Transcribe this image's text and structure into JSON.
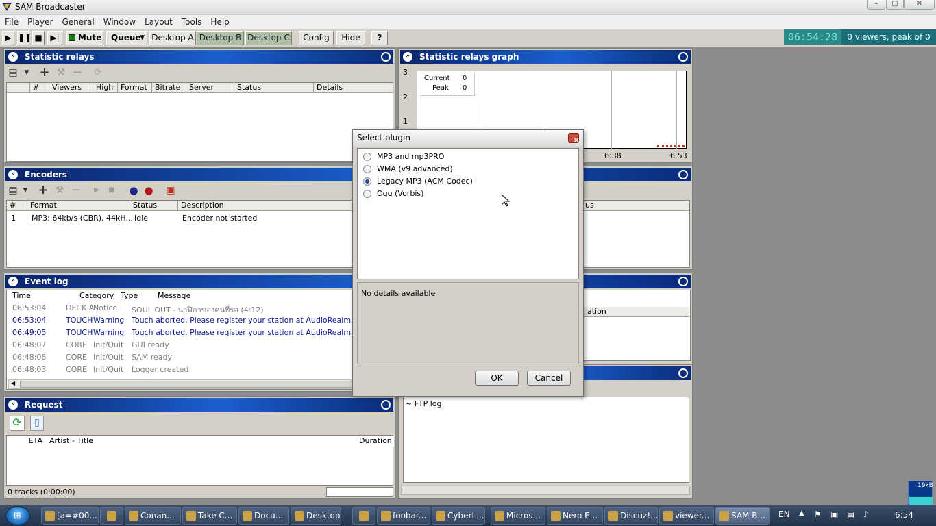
{
  "app": {
    "title": "SAM Broadcaster"
  },
  "menu": [
    "File",
    "Player",
    "General",
    "Window",
    "Layout",
    "Tools",
    "Help"
  ],
  "toolbar": {
    "mute": "Mute",
    "queue": "Queue",
    "desktop_a": "Desktop A",
    "desktop_b": "Desktop B",
    "desktop_c": "Desktop C",
    "config": "Config",
    "hide": "Hide",
    "help": "?",
    "clock": "06:54:28",
    "viewers": "0 viewers, peak of 0"
  },
  "statistic_relays": {
    "title": "Statistic relays",
    "columns": [
      "#",
      "Viewers",
      "High",
      "Format",
      "Bitrate",
      "Server",
      "Status",
      "Details"
    ]
  },
  "relays_graph": {
    "title": "Statistic relays graph",
    "y_ticks": [
      "3",
      "2",
      "1"
    ],
    "x_ticks": [
      "6:38",
      "6:53"
    ],
    "legend": [
      {
        "label": "Current",
        "value": "0"
      },
      {
        "label": "Peak",
        "value": "0"
      }
    ]
  },
  "encoders": {
    "title": "Encoders",
    "columns": [
      "#",
      "Format",
      "Status",
      "Description"
    ],
    "right_col_partial": "us",
    "rows": [
      {
        "num": "1",
        "format": "MP3: 64kb/s (CBR), 44kH...",
        "status": "Idle",
        "description": "Encoder not started"
      }
    ]
  },
  "event_log": {
    "title": "Event log",
    "columns": [
      "Time",
      "Category",
      "Type",
      "Message"
    ],
    "right_col_partial": "ation",
    "rows": [
      {
        "time": "06:53:04",
        "category": "DECK A",
        "type": "Notice",
        "message": "SOUL OUT - นาฬิกาของคนที่รอ (4:12)",
        "color": "#808080"
      },
      {
        "time": "06:53:04",
        "category": "TOUCH",
        "type": "Warning",
        "message": "Touch aborted. Please register your station at AudioRealm.com.",
        "color": "#0a1a8c"
      },
      {
        "time": "06:49:05",
        "category": "TOUCH",
        "type": "Warning",
        "message": "Touch aborted. Please register your station at AudioRealm.com.",
        "color": "#0a1a8c"
      },
      {
        "time": "06:48:07",
        "category": "CORE",
        "type": "Init/Quit",
        "message": "GUI ready",
        "color": "#808080"
      },
      {
        "time": "06:48:06",
        "category": "CORE",
        "type": "Init/Quit",
        "message": "SAM ready",
        "color": "#808080"
      },
      {
        "time": "06:48:03",
        "category": "CORE",
        "type": "Init/Quit",
        "message": "Logger created",
        "color": "#808080"
      }
    ]
  },
  "request": {
    "title": "Request",
    "columns": [
      "ETA",
      "Artist - Title",
      "Duration"
    ],
    "status": "0 tracks (0:00:00)"
  },
  "ftp_log": {
    "text": "~ FTP log"
  },
  "dialog": {
    "title": "Select plugin",
    "options": [
      {
        "label": "MP3 and mp3PRO",
        "selected": false
      },
      {
        "label": "WMA (v9 advanced)",
        "selected": false
      },
      {
        "label": "Legacy MP3 (ACM Codec)",
        "selected": true
      },
      {
        "label": "Ogg (Vorbis)",
        "selected": false
      }
    ],
    "details": "No details available",
    "ok": "OK",
    "cancel": "Cancel"
  },
  "netmeter": "19kB",
  "taskbar": {
    "items": [
      "[a=#00...",
      "Conan...",
      "Take C...",
      "Docu...",
      "Desktop",
      "foobar...",
      "CyberL...",
      "Micros...",
      "Nero E...",
      "Discuz!...",
      "viewer...",
      "SAM B..."
    ],
    "lang": "EN",
    "time": "6:54"
  }
}
